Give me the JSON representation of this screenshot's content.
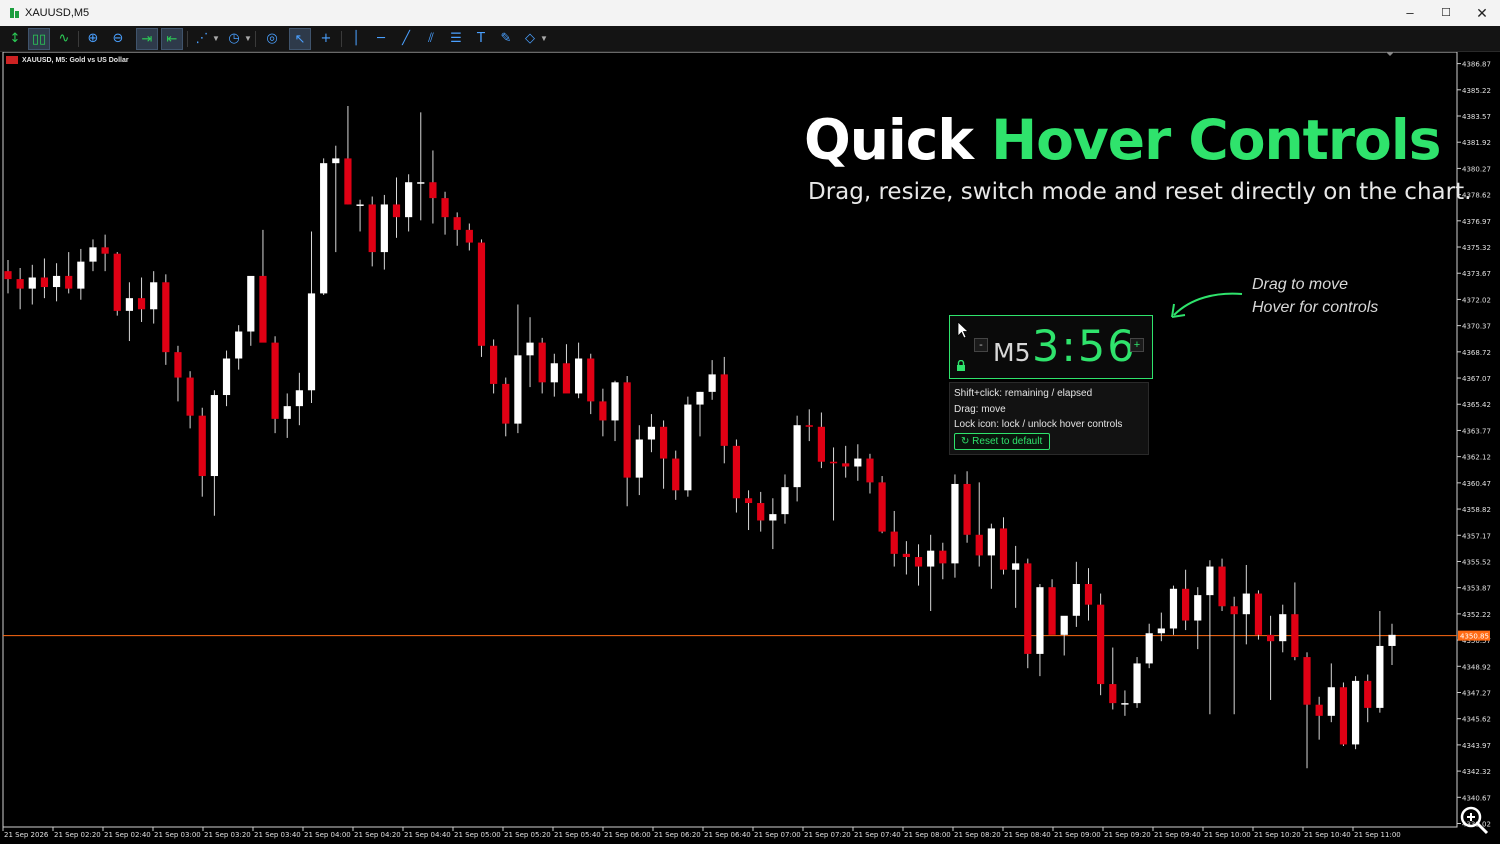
{
  "window": {
    "title": "XAUUSD,M5",
    "min": "–",
    "max": "☐",
    "close": "✕"
  },
  "toolbar": {
    "icons": [
      "new-order-icon",
      "candles-icon",
      "line-chart-icon",
      "zoom-in-icon",
      "zoom-out-icon",
      "autoscroll-icon",
      "chart-shift-icon",
      "indicators-icon",
      "periods-icon",
      "screenshot-icon",
      "cursor-icon",
      "crosshair-icon",
      "vertical-line-icon",
      "horizontal-line-icon",
      "trendline-icon",
      "channel-icon",
      "fibonacci-icon",
      "text-icon",
      "pencil-icon",
      "shapes-icon"
    ]
  },
  "chart": {
    "symbol_line": "XAUUSD, M5:  Gold vs US Dollar",
    "headline_white": "Quick ",
    "headline_green": "Hover Controls",
    "subheadline": "Drag, resize, switch mode and reset directly on the chart.",
    "hint_line1": "Drag to move",
    "hint_line2": "Hover for controls",
    "bid_label": "4350.85",
    "colors": {
      "bull": "#ffffff",
      "bear": "#e00014",
      "accent": "#2fe36c",
      "bid_line": "#ff6a13"
    }
  },
  "timer": {
    "timeframe": "M5",
    "countdown": "3:56",
    "minus": "-",
    "plus": "+"
  },
  "tooltip": {
    "line1": "Shift+click: remaining / elapsed",
    "line2": "Drag: move",
    "line3": "Lock icon: lock / unlock hover controls",
    "reset": "Reset to default"
  },
  "chart_data": {
    "type": "candlestick",
    "price_ticks": [
      "4386.87",
      "4385.22",
      "4383.57",
      "4381.92",
      "4380.27",
      "4378.62",
      "4376.97",
      "4375.32",
      "4373.67",
      "4372.02",
      "4370.37",
      "4368.72",
      "4367.07",
      "4365.42",
      "4363.77",
      "4362.12",
      "4360.47",
      "4358.82",
      "4357.17",
      "4355.52",
      "4353.87",
      "4352.22",
      "4350.57",
      "4348.92",
      "4347.27",
      "4345.62",
      "4343.97",
      "4342.32",
      "4340.67",
      "4339.02"
    ],
    "time_ticks": [
      "21 Sep 2026",
      "21 Sep 02:20",
      "21 Sep 02:40",
      "21 Sep 03:00",
      "21 Sep 03:20",
      "21 Sep 03:40",
      "21 Sep 04:00",
      "21 Sep 04:20",
      "21 Sep 04:40",
      "21 Sep 05:00",
      "21 Sep 05:20",
      "21 Sep 05:40",
      "21 Sep 06:00",
      "21 Sep 06:20",
      "21 Sep 06:40",
      "21 Sep 07:00",
      "21 Sep 07:20",
      "21 Sep 07:40",
      "21 Sep 08:00",
      "21 Sep 08:20",
      "21 Sep 08:40",
      "21 Sep 09:00",
      "21 Sep 09:20",
      "21 Sep 09:40",
      "21 Sep 10:00",
      "21 Sep 10:20",
      "21 Sep 10:40",
      "21 Sep 11:00"
    ],
    "ylim": [
      4338.8,
      4387.6
    ],
    "bid": 4350.85,
    "candles": [
      {
        "o": 4373.8,
        "h": 4374.5,
        "l": 4372.4,
        "c": 4373.3
      },
      {
        "o": 4373.3,
        "h": 4374.0,
        "l": 4371.4,
        "c": 4372.7
      },
      {
        "o": 4372.7,
        "h": 4374.2,
        "l": 4371.7,
        "c": 4373.4
      },
      {
        "o": 4373.4,
        "h": 4374.6,
        "l": 4372.1,
        "c": 4372.8
      },
      {
        "o": 4372.8,
        "h": 4374.3,
        "l": 4371.9,
        "c": 4373.5
      },
      {
        "o": 4373.5,
        "h": 4375.0,
        "l": 4372.4,
        "c": 4372.7
      },
      {
        "o": 4372.7,
        "h": 4375.2,
        "l": 4372.0,
        "c": 4374.4
      },
      {
        "o": 4374.4,
        "h": 4375.8,
        "l": 4373.8,
        "c": 4375.3
      },
      {
        "o": 4375.3,
        "h": 4376.1,
        "l": 4373.8,
        "c": 4374.9
      },
      {
        "o": 4374.9,
        "h": 4375.0,
        "l": 4371.0,
        "c": 4371.3
      },
      {
        "o": 4371.3,
        "h": 4373.1,
        "l": 4369.4,
        "c": 4372.1
      },
      {
        "o": 4372.1,
        "h": 4373.4,
        "l": 4370.6,
        "c": 4371.4
      },
      {
        "o": 4371.4,
        "h": 4373.8,
        "l": 4370.5,
        "c": 4373.1
      },
      {
        "o": 4373.1,
        "h": 4373.6,
        "l": 4367.9,
        "c": 4368.7
      },
      {
        "o": 4368.7,
        "h": 4369.1,
        "l": 4365.6,
        "c": 4367.1
      },
      {
        "o": 4367.1,
        "h": 4367.5,
        "l": 4363.9,
        "c": 4364.7
      },
      {
        "o": 4364.7,
        "h": 4365.2,
        "l": 4359.6,
        "c": 4360.9
      },
      {
        "o": 4360.9,
        "h": 4366.3,
        "l": 4358.4,
        "c": 4366.0
      },
      {
        "o": 4366.0,
        "h": 4368.8,
        "l": 4365.3,
        "c": 4368.3
      },
      {
        "o": 4368.3,
        "h": 4370.4,
        "l": 4367.6,
        "c": 4370.0
      },
      {
        "o": 4370.0,
        "h": 4372.9,
        "l": 4369.1,
        "c": 4373.5
      },
      {
        "o": 4373.5,
        "h": 4376.4,
        "l": 4372.8,
        "c": 4369.3
      },
      {
        "o": 4369.3,
        "h": 4369.7,
        "l": 4363.6,
        "c": 4364.5
      },
      {
        "o": 4364.5,
        "h": 4366.1,
        "l": 4363.3,
        "c": 4365.3
      },
      {
        "o": 4365.3,
        "h": 4367.4,
        "l": 4364.1,
        "c": 4366.3
      },
      {
        "o": 4366.3,
        "h": 4376.3,
        "l": 4365.5,
        "c": 4372.4
      },
      {
        "o": 4372.4,
        "h": 4380.9,
        "l": 4372.3,
        "c": 4380.6
      },
      {
        "o": 4380.6,
        "h": 4381.7,
        "l": 4375.0,
        "c": 4380.9
      },
      {
        "o": 4380.9,
        "h": 4384.2,
        "l": 4378.0,
        "c": 4378.0
      },
      {
        "o": 4378.0,
        "h": 4378.3,
        "l": 4376.3,
        "c": 4378.0
      },
      {
        "o": 4378.0,
        "h": 4378.5,
        "l": 4374.1,
        "c": 4375.0
      },
      {
        "o": 4375.0,
        "h": 4378.6,
        "l": 4373.9,
        "c": 4378.0
      },
      {
        "o": 4378.0,
        "h": 4379.7,
        "l": 4375.9,
        "c": 4377.2
      },
      {
        "o": 4377.2,
        "h": 4379.9,
        "l": 4376.3,
        "c": 4379.4
      },
      {
        "o": 4379.4,
        "h": 4383.8,
        "l": 4377.0,
        "c": 4379.4
      },
      {
        "o": 4379.4,
        "h": 4381.4,
        "l": 4376.8,
        "c": 4378.4
      },
      {
        "o": 4378.4,
        "h": 4378.8,
        "l": 4376.1,
        "c": 4377.2
      },
      {
        "o": 4377.2,
        "h": 4377.5,
        "l": 4375.4,
        "c": 4376.4
      },
      {
        "o": 4376.4,
        "h": 4376.8,
        "l": 4375.1,
        "c": 4375.6
      },
      {
        "o": 4375.6,
        "h": 4375.8,
        "l": 4368.4,
        "c": 4369.1
      },
      {
        "o": 4369.1,
        "h": 4369.5,
        "l": 4366.1,
        "c": 4366.7
      },
      {
        "o": 4366.7,
        "h": 4367.1,
        "l": 4363.4,
        "c": 4364.2
      },
      {
        "o": 4364.2,
        "h": 4371.7,
        "l": 4363.6,
        "c": 4368.5
      },
      {
        "o": 4368.5,
        "h": 4370.9,
        "l": 4366.5,
        "c": 4369.3
      },
      {
        "o": 4369.3,
        "h": 4369.6,
        "l": 4366.1,
        "c": 4366.8
      },
      {
        "o": 4366.8,
        "h": 4368.6,
        "l": 4365.9,
        "c": 4368.0
      },
      {
        "o": 4368.0,
        "h": 4369.2,
        "l": 4366.8,
        "c": 4366.1
      },
      {
        "o": 4366.1,
        "h": 4369.3,
        "l": 4365.8,
        "c": 4368.3
      },
      {
        "o": 4368.3,
        "h": 4368.6,
        "l": 4364.8,
        "c": 4365.6
      },
      {
        "o": 4365.6,
        "h": 4366.4,
        "l": 4363.4,
        "c": 4364.4
      },
      {
        "o": 4364.4,
        "h": 4366.9,
        "l": 4363.1,
        "c": 4366.8
      },
      {
        "o": 4366.8,
        "h": 4367.2,
        "l": 4359.0,
        "c": 4360.8
      },
      {
        "o": 4360.8,
        "h": 4364.1,
        "l": 4359.7,
        "c": 4363.2
      },
      {
        "o": 4363.2,
        "h": 4364.8,
        "l": 4362.4,
        "c": 4364.0
      },
      {
        "o": 4364.0,
        "h": 4364.4,
        "l": 4360.1,
        "c": 4362.0
      },
      {
        "o": 4362.0,
        "h": 4362.5,
        "l": 4359.4,
        "c": 4360.0
      },
      {
        "o": 4360.0,
        "h": 4365.9,
        "l": 4359.6,
        "c": 4365.4
      },
      {
        "o": 4365.4,
        "h": 4366.2,
        "l": 4363.4,
        "c": 4366.2
      },
      {
        "o": 4366.2,
        "h": 4368.2,
        "l": 4365.7,
        "c": 4367.3
      },
      {
        "o": 4367.3,
        "h": 4368.4,
        "l": 4361.7,
        "c": 4362.8
      },
      {
        "o": 4362.8,
        "h": 4363.2,
        "l": 4358.6,
        "c": 4359.5
      },
      {
        "o": 4359.5,
        "h": 4360.0,
        "l": 4357.5,
        "c": 4359.2
      },
      {
        "o": 4359.2,
        "h": 4359.9,
        "l": 4357.4,
        "c": 4358.1
      },
      {
        "o": 4358.1,
        "h": 4359.5,
        "l": 4356.3,
        "c": 4358.5
      },
      {
        "o": 4358.5,
        "h": 4361.0,
        "l": 4357.9,
        "c": 4360.2
      },
      {
        "o": 4360.2,
        "h": 4364.7,
        "l": 4359.3,
        "c": 4364.1
      },
      {
        "o": 4364.1,
        "h": 4365.1,
        "l": 4363.1,
        "c": 4364.0
      },
      {
        "o": 4364.0,
        "h": 4364.9,
        "l": 4361.4,
        "c": 4361.8
      },
      {
        "o": 4361.8,
        "h": 4362.7,
        "l": 4358.1,
        "c": 4361.7
      },
      {
        "o": 4361.7,
        "h": 4362.8,
        "l": 4360.8,
        "c": 4361.5
      },
      {
        "o": 4361.5,
        "h": 4362.9,
        "l": 4360.6,
        "c": 4362.0
      },
      {
        "o": 4362.0,
        "h": 4362.3,
        "l": 4359.8,
        "c": 4360.5
      },
      {
        "o": 4360.5,
        "h": 4360.9,
        "l": 4357.3,
        "c": 4357.4
      },
      {
        "o": 4357.4,
        "h": 4358.7,
        "l": 4355.2,
        "c": 4356.0
      },
      {
        "o": 4356.0,
        "h": 4356.8,
        "l": 4354.7,
        "c": 4355.8
      },
      {
        "o": 4355.8,
        "h": 4356.6,
        "l": 4354.0,
        "c": 4355.2
      },
      {
        "o": 4355.2,
        "h": 4357.2,
        "l": 4352.4,
        "c": 4356.2
      },
      {
        "o": 4356.2,
        "h": 4356.7,
        "l": 4354.4,
        "c": 4355.4
      },
      {
        "o": 4355.4,
        "h": 4361.0,
        "l": 4354.5,
        "c": 4360.4
      },
      {
        "o": 4360.4,
        "h": 4361.2,
        "l": 4356.7,
        "c": 4357.2
      },
      {
        "o": 4357.2,
        "h": 4360.5,
        "l": 4355.2,
        "c": 4355.9
      },
      {
        "o": 4355.9,
        "h": 4357.9,
        "l": 4353.8,
        "c": 4357.6
      },
      {
        "o": 4357.6,
        "h": 4358.3,
        "l": 4354.7,
        "c": 4355.0
      },
      {
        "o": 4355.0,
        "h": 4356.5,
        "l": 4352.6,
        "c": 4355.4
      },
      {
        "o": 4355.4,
        "h": 4355.7,
        "l": 4348.8,
        "c": 4349.7
      },
      {
        "o": 4349.7,
        "h": 4354.1,
        "l": 4348.3,
        "c": 4353.9
      },
      {
        "o": 4353.9,
        "h": 4354.4,
        "l": 4351.0,
        "c": 4350.9
      },
      {
        "o": 4350.9,
        "h": 4351.6,
        "l": 4349.6,
        "c": 4352.1
      },
      {
        "o": 4352.1,
        "h": 4355.5,
        "l": 4351.4,
        "c": 4354.1
      },
      {
        "o": 4354.1,
        "h": 4355.1,
        "l": 4351.8,
        "c": 4352.8
      },
      {
        "o": 4352.8,
        "h": 4353.5,
        "l": 4347.1,
        "c": 4347.8
      },
      {
        "o": 4347.8,
        "h": 4350.1,
        "l": 4346.2,
        "c": 4346.6
      },
      {
        "o": 4346.6,
        "h": 4347.4,
        "l": 4345.8,
        "c": 4346.6
      },
      {
        "o": 4346.6,
        "h": 4349.5,
        "l": 4346.3,
        "c": 4349.1
      },
      {
        "o": 4349.1,
        "h": 4351.6,
        "l": 4348.8,
        "c": 4351.0
      },
      {
        "o": 4351.0,
        "h": 4352.3,
        "l": 4350.5,
        "c": 4351.3
      },
      {
        "o": 4351.3,
        "h": 4354.0,
        "l": 4350.9,
        "c": 4353.8
      },
      {
        "o": 4353.8,
        "h": 4355.0,
        "l": 4351.2,
        "c": 4351.8
      },
      {
        "o": 4351.8,
        "h": 4353.9,
        "l": 4350.0,
        "c": 4353.4
      },
      {
        "o": 4353.4,
        "h": 4355.6,
        "l": 4345.9,
        "c": 4355.2
      },
      {
        "o": 4355.2,
        "h": 4355.7,
        "l": 4352.4,
        "c": 4352.7
      },
      {
        "o": 4352.7,
        "h": 4353.3,
        "l": 4345.9,
        "c": 4352.2
      },
      {
        "o": 4352.2,
        "h": 4355.3,
        "l": 4350.3,
        "c": 4353.5
      },
      {
        "o": 4353.5,
        "h": 4353.7,
        "l": 4350.6,
        "c": 4350.9
      },
      {
        "o": 4350.9,
        "h": 4352.1,
        "l": 4346.8,
        "c": 4350.5
      },
      {
        "o": 4350.5,
        "h": 4352.8,
        "l": 4349.8,
        "c": 4352.2
      },
      {
        "o": 4352.2,
        "h": 4354.2,
        "l": 4349.3,
        "c": 4349.5
      },
      {
        "o": 4349.5,
        "h": 4349.8,
        "l": 4342.5,
        "c": 4346.5
      },
      {
        "o": 4346.5,
        "h": 4347.0,
        "l": 4344.3,
        "c": 4345.8
      },
      {
        "o": 4345.8,
        "h": 4349.1,
        "l": 4345.4,
        "c": 4347.6
      },
      {
        "o": 4347.6,
        "h": 4347.9,
        "l": 4343.9,
        "c": 4344.0
      },
      {
        "o": 4344.0,
        "h": 4348.3,
        "l": 4343.7,
        "c": 4348.0
      },
      {
        "o": 4348.0,
        "h": 4348.4,
        "l": 4345.4,
        "c": 4346.3
      },
      {
        "o": 4346.3,
        "h": 4352.4,
        "l": 4346.0,
        "c": 4350.2
      },
      {
        "o": 4350.2,
        "h": 4351.6,
        "l": 4349.0,
        "c": 4350.9
      }
    ]
  }
}
